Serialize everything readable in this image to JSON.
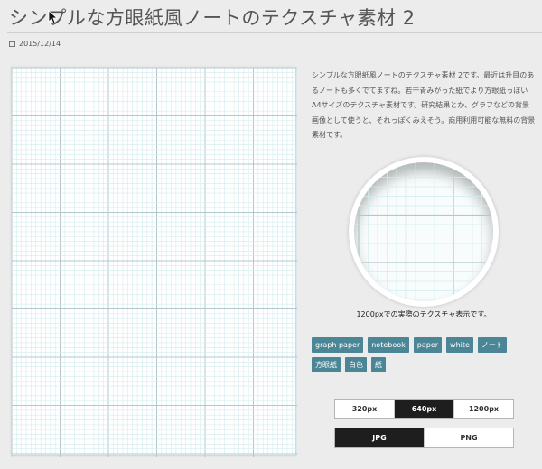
{
  "page": {
    "title": "シンプルな方眼紙風ノートのテクスチャ素材 2",
    "date": "2015/12/14",
    "date_icon": "calendar-icon"
  },
  "description": "シンプルな方眼紙風ノートのテクスチャ素材 2です。最近は升目のあるノートも多くでてますね。若干青みがった紙でより方眼紙っぽいA4サイズのテクスチャ素材です。研究結果とか、グラフなどの背景画像として使うと、それっぽくみえそう。商用利用可能な無料の背景素材です。",
  "preview": {
    "caption": "1200pxでの実際のテクスチャ表示です。"
  },
  "tags": [
    "graph paper",
    "notebook",
    "paper",
    "white",
    "ノート",
    "方眼紙",
    "白色",
    "紙"
  ],
  "size_options": {
    "items": [
      "320px",
      "640px",
      "1200px"
    ],
    "selected": "640px"
  },
  "format_options": {
    "items": [
      "JPG",
      "PNG"
    ],
    "selected": "JPG"
  },
  "colors": {
    "tag_bg": "#4a8696",
    "grid_minor": "#d3ebee",
    "grid_major": "#b4c7cc",
    "active_button": "#1e1e1e"
  }
}
